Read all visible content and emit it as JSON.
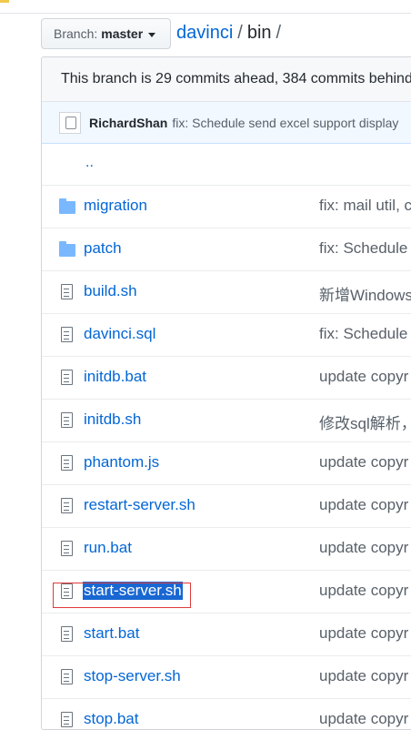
{
  "header": {
    "branch_label": "Branch:",
    "branch_value": "master",
    "repo": "davinci",
    "separator": "/",
    "folder": "bin",
    "trailing_separator": "/"
  },
  "branch_info": "This branch is 29 commits ahead, 384 commits behind",
  "commit": {
    "author": "RichardShan",
    "message": "fix: Schedule send excel support display"
  },
  "parent_dir": "..",
  "files": [
    {
      "type": "folder-icon",
      "name": "migration",
      "message": "fix: mail util, c"
    },
    {
      "type": "folder-icon",
      "name": "patch",
      "message": "fix: Schedule"
    },
    {
      "type": "file-icon",
      "name": "build.sh",
      "message": "新增Windows"
    },
    {
      "type": "file-icon",
      "name": "davinci.sql",
      "message": "fix: Schedule"
    },
    {
      "type": "file-icon",
      "name": "initdb.bat",
      "message": "update copyr"
    },
    {
      "type": "file-icon",
      "name": "initdb.sh",
      "message": "修改sql解析，"
    },
    {
      "type": "file-icon",
      "name": "phantom.js",
      "message": "update copyr"
    },
    {
      "type": "file-icon",
      "name": "restart-server.sh",
      "message": "update copyr"
    },
    {
      "type": "file-icon",
      "name": "run.bat",
      "message": "update copyr"
    },
    {
      "type": "file-icon",
      "name": "start-server.sh",
      "message": "update copyr",
      "selected": true
    },
    {
      "type": "file-icon",
      "name": "start.bat",
      "message": "update copyr"
    },
    {
      "type": "file-icon",
      "name": "stop-server.sh",
      "message": "update copyr"
    },
    {
      "type": "file-icon",
      "name": "stop.bat",
      "message": "update copyr"
    }
  ],
  "colors": {
    "link": "#0366d6",
    "folder": "#79b8ff",
    "selection": "#1967d2",
    "highlight_box": "#e03b3b"
  }
}
